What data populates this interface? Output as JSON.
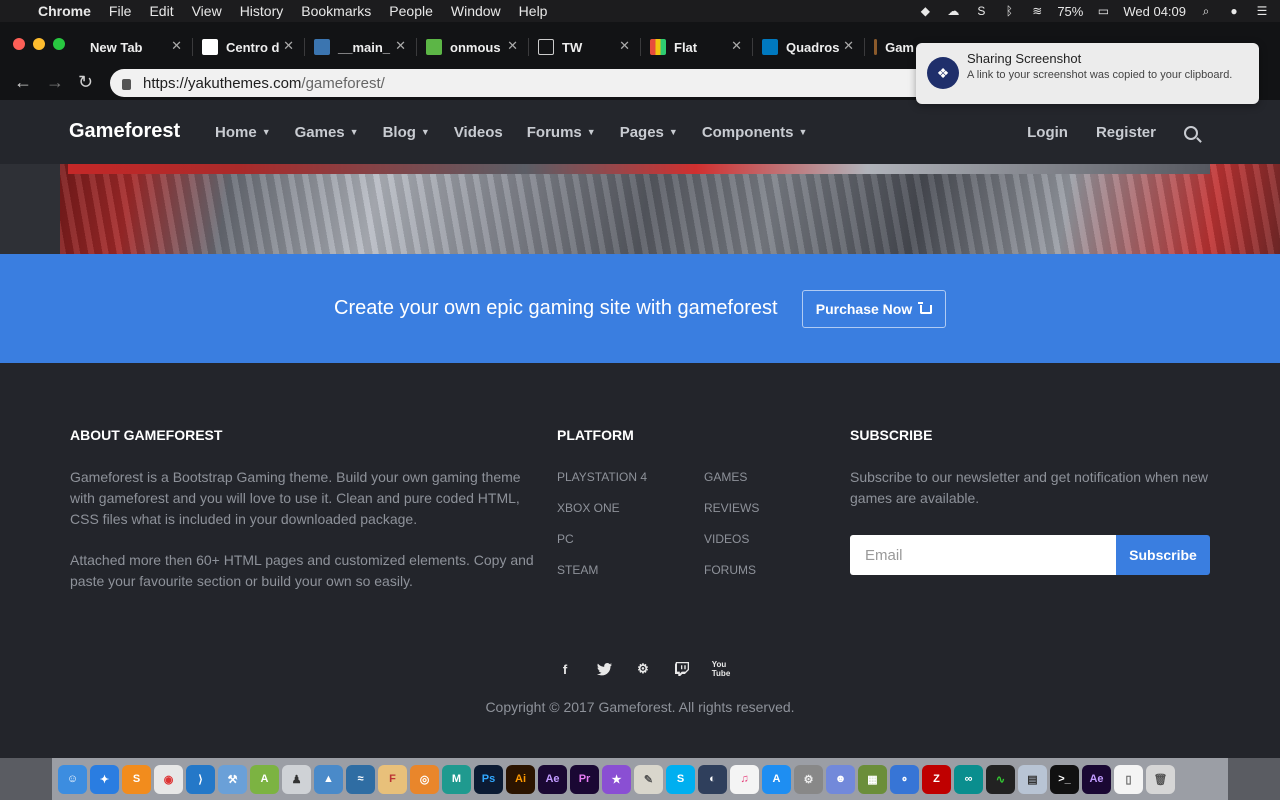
{
  "menubar": {
    "app": "Chrome",
    "items": [
      "File",
      "Edit",
      "View",
      "History",
      "Bookmarks",
      "People",
      "Window",
      "Help"
    ],
    "battery": "75%",
    "clock": "Wed 04:09"
  },
  "tabs": [
    {
      "label": "New Tab",
      "favicon": "none"
    },
    {
      "label": "Centro d",
      "favicon": "doc-icon"
    },
    {
      "label": "__main_",
      "favicon": "python-icon"
    },
    {
      "label": "onmous",
      "favicon": "chart-icon"
    },
    {
      "label": "TW",
      "favicon": "page-icon"
    },
    {
      "label": "Flat",
      "favicon": "grid-icon"
    },
    {
      "label": "Quadros",
      "favicon": "trello-icon"
    },
    {
      "label": "Gam",
      "favicon": "game-icon"
    }
  ],
  "address": {
    "host": "https://yakuthemes.com",
    "path": "/gameforest/"
  },
  "notification": {
    "title": "Sharing Screenshot",
    "body": "A link to your screenshot was copied to your clipboard."
  },
  "site": {
    "logo": "Gameforest",
    "nav": [
      "Home",
      "Games",
      "Blog",
      "Videos",
      "Forums",
      "Pages",
      "Components"
    ],
    "nav_has_caret": [
      true,
      true,
      true,
      false,
      true,
      true,
      true
    ],
    "login": "Login",
    "register": "Register"
  },
  "cta": {
    "text": "Create your own epic gaming site with gameforest",
    "button": "Purchase Now"
  },
  "footer": {
    "about_title": "ABOUT GAMEFOREST",
    "about_p1": "Gameforest is a Bootstrap Gaming theme. Build your own gaming theme with gameforest and you will love to use it. Clean and pure coded HTML, CSS files what is included in your downloaded package.",
    "about_p2": "Attached more then 60+ HTML pages and customized elements. Copy and paste your favourite section or build your own so easily.",
    "platform_title": "PLATFORM",
    "platform_col1": [
      "PLAYSTATION 4",
      "XBOX ONE",
      "PC",
      "STEAM"
    ],
    "platform_col2": [
      "GAMES",
      "REVIEWS",
      "VIDEOS",
      "FORUMS"
    ],
    "subscribe_title": "SUBSCRIBE",
    "subscribe_text": "Subscribe to our newsletter and get notification when new games are available.",
    "email_placeholder": "Email",
    "subscribe_button": "Subscribe",
    "social": [
      "facebook-icon",
      "twitter-icon",
      "steam-icon",
      "twitch-icon",
      "youtube-icon"
    ],
    "copyright": "Copyright © 2017 Gameforest. All rights reserved."
  },
  "colors": {
    "accent": "#3a7ee0",
    "footer_bg": "#23252b",
    "nav_bg": "#24262c"
  }
}
